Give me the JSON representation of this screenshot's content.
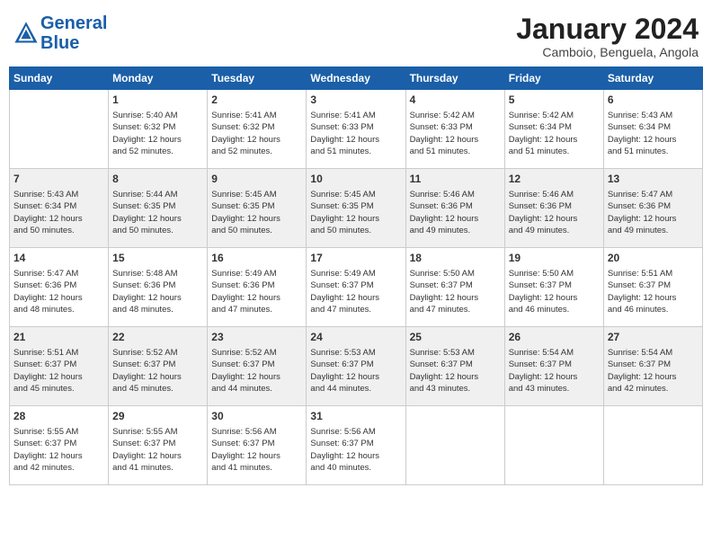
{
  "header": {
    "logo_line1": "General",
    "logo_line2": "Blue",
    "month": "January 2024",
    "location": "Camboio, Benguela, Angola"
  },
  "columns": [
    "Sunday",
    "Monday",
    "Tuesday",
    "Wednesday",
    "Thursday",
    "Friday",
    "Saturday"
  ],
  "weeks": [
    [
      {
        "day": "",
        "info": ""
      },
      {
        "day": "1",
        "info": "Sunrise: 5:40 AM\nSunset: 6:32 PM\nDaylight: 12 hours\nand 52 minutes."
      },
      {
        "day": "2",
        "info": "Sunrise: 5:41 AM\nSunset: 6:32 PM\nDaylight: 12 hours\nand 52 minutes."
      },
      {
        "day": "3",
        "info": "Sunrise: 5:41 AM\nSunset: 6:33 PM\nDaylight: 12 hours\nand 51 minutes."
      },
      {
        "day": "4",
        "info": "Sunrise: 5:42 AM\nSunset: 6:33 PM\nDaylight: 12 hours\nand 51 minutes."
      },
      {
        "day": "5",
        "info": "Sunrise: 5:42 AM\nSunset: 6:34 PM\nDaylight: 12 hours\nand 51 minutes."
      },
      {
        "day": "6",
        "info": "Sunrise: 5:43 AM\nSunset: 6:34 PM\nDaylight: 12 hours\nand 51 minutes."
      }
    ],
    [
      {
        "day": "7",
        "info": "Sunrise: 5:43 AM\nSunset: 6:34 PM\nDaylight: 12 hours\nand 50 minutes."
      },
      {
        "day": "8",
        "info": "Sunrise: 5:44 AM\nSunset: 6:35 PM\nDaylight: 12 hours\nand 50 minutes."
      },
      {
        "day": "9",
        "info": "Sunrise: 5:45 AM\nSunset: 6:35 PM\nDaylight: 12 hours\nand 50 minutes."
      },
      {
        "day": "10",
        "info": "Sunrise: 5:45 AM\nSunset: 6:35 PM\nDaylight: 12 hours\nand 50 minutes."
      },
      {
        "day": "11",
        "info": "Sunrise: 5:46 AM\nSunset: 6:36 PM\nDaylight: 12 hours\nand 49 minutes."
      },
      {
        "day": "12",
        "info": "Sunrise: 5:46 AM\nSunset: 6:36 PM\nDaylight: 12 hours\nand 49 minutes."
      },
      {
        "day": "13",
        "info": "Sunrise: 5:47 AM\nSunset: 6:36 PM\nDaylight: 12 hours\nand 49 minutes."
      }
    ],
    [
      {
        "day": "14",
        "info": "Sunrise: 5:47 AM\nSunset: 6:36 PM\nDaylight: 12 hours\nand 48 minutes."
      },
      {
        "day": "15",
        "info": "Sunrise: 5:48 AM\nSunset: 6:36 PM\nDaylight: 12 hours\nand 48 minutes."
      },
      {
        "day": "16",
        "info": "Sunrise: 5:49 AM\nSunset: 6:36 PM\nDaylight: 12 hours\nand 47 minutes."
      },
      {
        "day": "17",
        "info": "Sunrise: 5:49 AM\nSunset: 6:37 PM\nDaylight: 12 hours\nand 47 minutes."
      },
      {
        "day": "18",
        "info": "Sunrise: 5:50 AM\nSunset: 6:37 PM\nDaylight: 12 hours\nand 47 minutes."
      },
      {
        "day": "19",
        "info": "Sunrise: 5:50 AM\nSunset: 6:37 PM\nDaylight: 12 hours\nand 46 minutes."
      },
      {
        "day": "20",
        "info": "Sunrise: 5:51 AM\nSunset: 6:37 PM\nDaylight: 12 hours\nand 46 minutes."
      }
    ],
    [
      {
        "day": "21",
        "info": "Sunrise: 5:51 AM\nSunset: 6:37 PM\nDaylight: 12 hours\nand 45 minutes."
      },
      {
        "day": "22",
        "info": "Sunrise: 5:52 AM\nSunset: 6:37 PM\nDaylight: 12 hours\nand 45 minutes."
      },
      {
        "day": "23",
        "info": "Sunrise: 5:52 AM\nSunset: 6:37 PM\nDaylight: 12 hours\nand 44 minutes."
      },
      {
        "day": "24",
        "info": "Sunrise: 5:53 AM\nSunset: 6:37 PM\nDaylight: 12 hours\nand 44 minutes."
      },
      {
        "day": "25",
        "info": "Sunrise: 5:53 AM\nSunset: 6:37 PM\nDaylight: 12 hours\nand 43 minutes."
      },
      {
        "day": "26",
        "info": "Sunrise: 5:54 AM\nSunset: 6:37 PM\nDaylight: 12 hours\nand 43 minutes."
      },
      {
        "day": "27",
        "info": "Sunrise: 5:54 AM\nSunset: 6:37 PM\nDaylight: 12 hours\nand 42 minutes."
      }
    ],
    [
      {
        "day": "28",
        "info": "Sunrise: 5:55 AM\nSunset: 6:37 PM\nDaylight: 12 hours\nand 42 minutes."
      },
      {
        "day": "29",
        "info": "Sunrise: 5:55 AM\nSunset: 6:37 PM\nDaylight: 12 hours\nand 41 minutes."
      },
      {
        "day": "30",
        "info": "Sunrise: 5:56 AM\nSunset: 6:37 PM\nDaylight: 12 hours\nand 41 minutes."
      },
      {
        "day": "31",
        "info": "Sunrise: 5:56 AM\nSunset: 6:37 PM\nDaylight: 12 hours\nand 40 minutes."
      },
      {
        "day": "",
        "info": ""
      },
      {
        "day": "",
        "info": ""
      },
      {
        "day": "",
        "info": ""
      }
    ]
  ]
}
